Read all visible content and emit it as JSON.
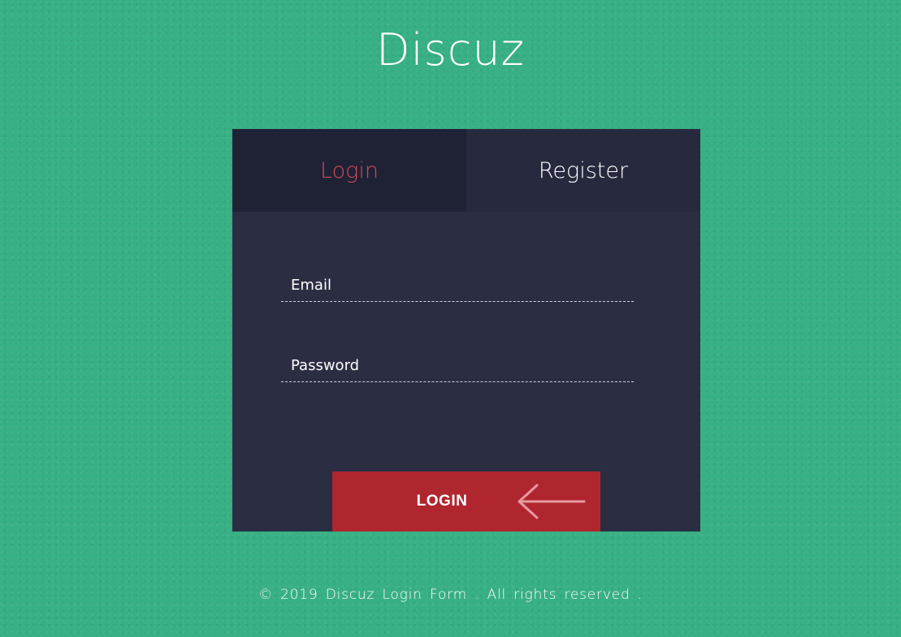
{
  "header": {
    "title": "Discuz"
  },
  "tabs": [
    {
      "label": "Login",
      "active": true
    },
    {
      "label": "Register",
      "active": false
    }
  ],
  "form": {
    "email": {
      "placeholder": "Email",
      "value": ""
    },
    "password": {
      "placeholder": "Password",
      "value": ""
    },
    "submit_label": "LOGIN"
  },
  "icons": {
    "submit_arrow": "arrow-left-icon"
  },
  "footer": {
    "text": "© 2019 Discuz Login Form . All rights reserved ."
  },
  "colors": {
    "page_background": "#37b083",
    "card_background": "#2b2e43",
    "active_tab_background": "#1f2135",
    "inactive_tab_background": "#272a3e",
    "active_tab_text": "#d04b55",
    "button_background": "#b0262f"
  }
}
